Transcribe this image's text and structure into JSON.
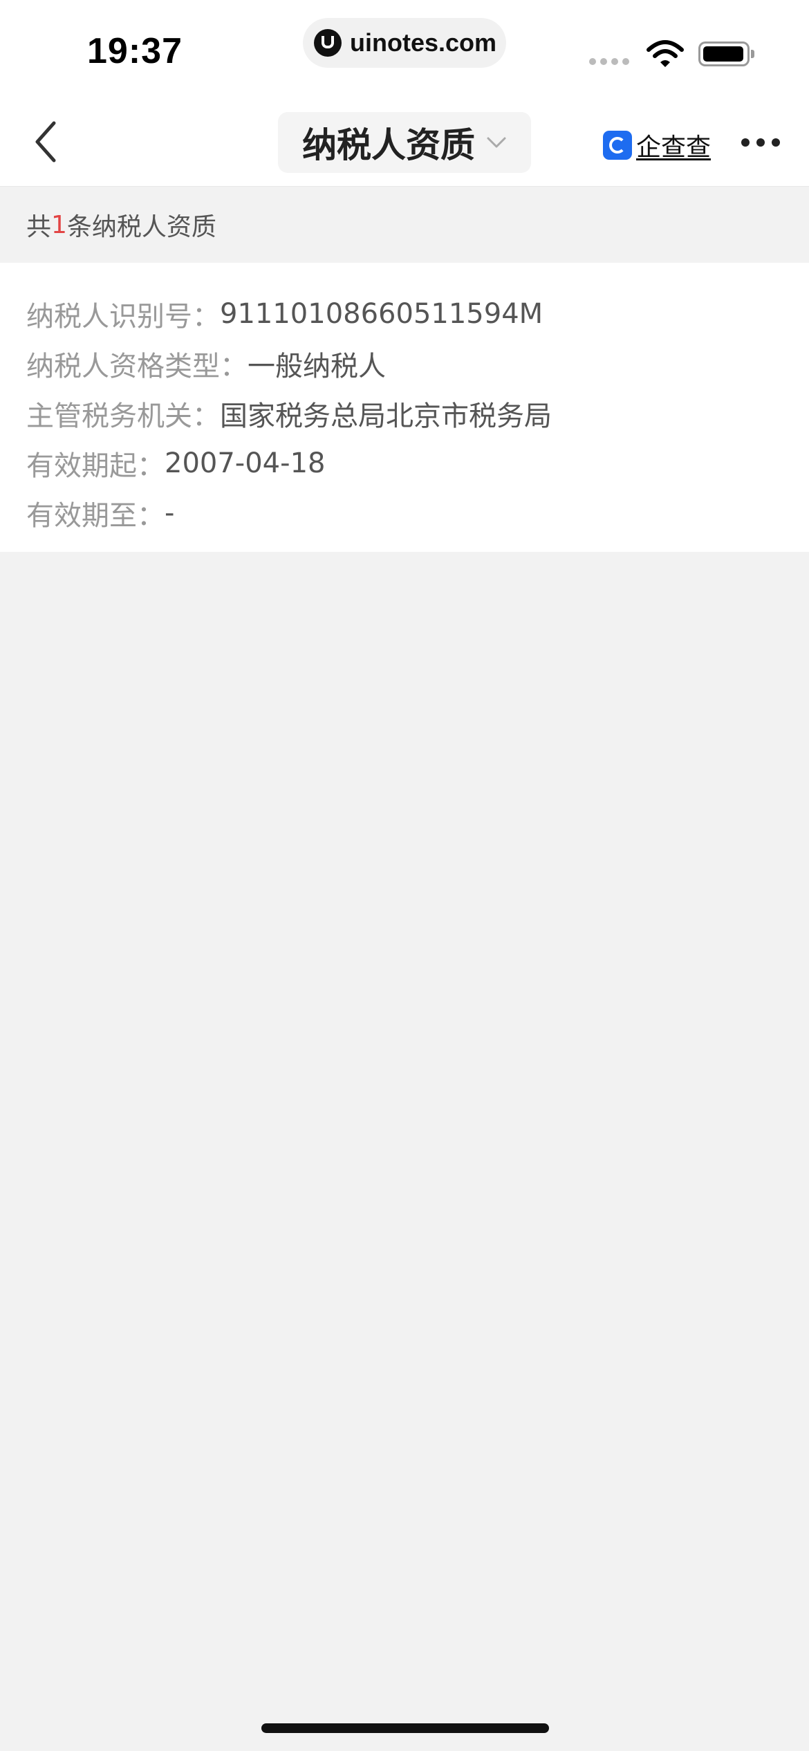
{
  "status_bar": {
    "time": "19:37",
    "url": "uinotes.com"
  },
  "nav": {
    "back_icon": "chevron-left-icon",
    "title": "纳税人资质",
    "title_dropdown_icon": "chevron-down-icon",
    "brand": "企查查",
    "brand_icon": "qichacha-logo-icon",
    "more_icon": "more-dots-icon"
  },
  "summary": {
    "prefix": "共",
    "count": "1",
    "suffix": "条纳税人资质"
  },
  "record": [
    {
      "label": "纳税人识别号：",
      "value": "91110108660511594M"
    },
    {
      "label": "纳税人资格类型：",
      "value": "一般纳税人"
    },
    {
      "label": "主管税务机关：",
      "value": "国家税务总局北京市税务局"
    },
    {
      "label": "有效期起：",
      "value": "2007-04-18"
    },
    {
      "label": "有效期至：",
      "value": "-"
    }
  ],
  "colors": {
    "accent_count": "#e24545",
    "brand_blue": "#1e6cf0",
    "background": "#f2f2f2"
  }
}
